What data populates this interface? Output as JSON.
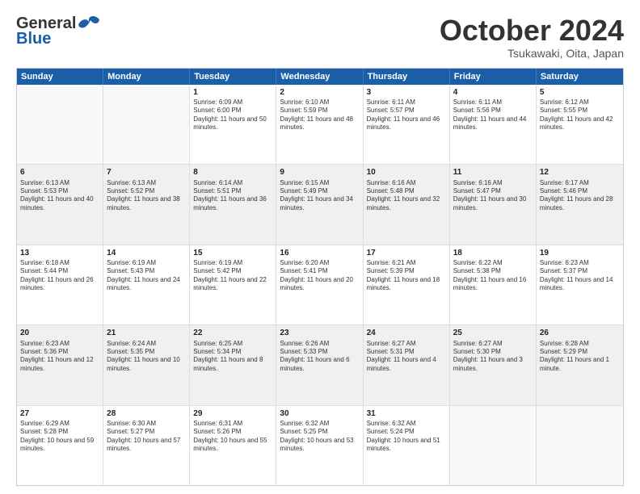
{
  "header": {
    "logo_general": "General",
    "logo_blue": "Blue",
    "month_title": "October 2024",
    "subtitle": "Tsukawaki, Oita, Japan"
  },
  "calendar": {
    "days": [
      "Sunday",
      "Monday",
      "Tuesday",
      "Wednesday",
      "Thursday",
      "Friday",
      "Saturday"
    ],
    "rows": [
      [
        {
          "day": "",
          "empty": true
        },
        {
          "day": "",
          "empty": true
        },
        {
          "day": "1",
          "sunrise": "Sunrise: 6:09 AM",
          "sunset": "Sunset: 6:00 PM",
          "daylight": "Daylight: 11 hours and 50 minutes."
        },
        {
          "day": "2",
          "sunrise": "Sunrise: 6:10 AM",
          "sunset": "Sunset: 5:59 PM",
          "daylight": "Daylight: 11 hours and 48 minutes."
        },
        {
          "day": "3",
          "sunrise": "Sunrise: 6:11 AM",
          "sunset": "Sunset: 5:57 PM",
          "daylight": "Daylight: 11 hours and 46 minutes."
        },
        {
          "day": "4",
          "sunrise": "Sunrise: 6:11 AM",
          "sunset": "Sunset: 5:56 PM",
          "daylight": "Daylight: 11 hours and 44 minutes."
        },
        {
          "day": "5",
          "sunrise": "Sunrise: 6:12 AM",
          "sunset": "Sunset: 5:55 PM",
          "daylight": "Daylight: 11 hours and 42 minutes."
        }
      ],
      [
        {
          "day": "6",
          "sunrise": "Sunrise: 6:13 AM",
          "sunset": "Sunset: 5:53 PM",
          "daylight": "Daylight: 11 hours and 40 minutes."
        },
        {
          "day": "7",
          "sunrise": "Sunrise: 6:13 AM",
          "sunset": "Sunset: 5:52 PM",
          "daylight": "Daylight: 11 hours and 38 minutes."
        },
        {
          "day": "8",
          "sunrise": "Sunrise: 6:14 AM",
          "sunset": "Sunset: 5:51 PM",
          "daylight": "Daylight: 11 hours and 36 minutes."
        },
        {
          "day": "9",
          "sunrise": "Sunrise: 6:15 AM",
          "sunset": "Sunset: 5:49 PM",
          "daylight": "Daylight: 11 hours and 34 minutes."
        },
        {
          "day": "10",
          "sunrise": "Sunrise: 6:16 AM",
          "sunset": "Sunset: 5:48 PM",
          "daylight": "Daylight: 11 hours and 32 minutes."
        },
        {
          "day": "11",
          "sunrise": "Sunrise: 6:16 AM",
          "sunset": "Sunset: 5:47 PM",
          "daylight": "Daylight: 11 hours and 30 minutes."
        },
        {
          "day": "12",
          "sunrise": "Sunrise: 6:17 AM",
          "sunset": "Sunset: 5:46 PM",
          "daylight": "Daylight: 11 hours and 28 minutes."
        }
      ],
      [
        {
          "day": "13",
          "sunrise": "Sunrise: 6:18 AM",
          "sunset": "Sunset: 5:44 PM",
          "daylight": "Daylight: 11 hours and 26 minutes."
        },
        {
          "day": "14",
          "sunrise": "Sunrise: 6:19 AM",
          "sunset": "Sunset: 5:43 PM",
          "daylight": "Daylight: 11 hours and 24 minutes."
        },
        {
          "day": "15",
          "sunrise": "Sunrise: 6:19 AM",
          "sunset": "Sunset: 5:42 PM",
          "daylight": "Daylight: 11 hours and 22 minutes."
        },
        {
          "day": "16",
          "sunrise": "Sunrise: 6:20 AM",
          "sunset": "Sunset: 5:41 PM",
          "daylight": "Daylight: 11 hours and 20 minutes."
        },
        {
          "day": "17",
          "sunrise": "Sunrise: 6:21 AM",
          "sunset": "Sunset: 5:39 PM",
          "daylight": "Daylight: 11 hours and 18 minutes."
        },
        {
          "day": "18",
          "sunrise": "Sunrise: 6:22 AM",
          "sunset": "Sunset: 5:38 PM",
          "daylight": "Daylight: 11 hours and 16 minutes."
        },
        {
          "day": "19",
          "sunrise": "Sunrise: 6:23 AM",
          "sunset": "Sunset: 5:37 PM",
          "daylight": "Daylight: 11 hours and 14 minutes."
        }
      ],
      [
        {
          "day": "20",
          "sunrise": "Sunrise: 6:23 AM",
          "sunset": "Sunset: 5:36 PM",
          "daylight": "Daylight: 11 hours and 12 minutes."
        },
        {
          "day": "21",
          "sunrise": "Sunrise: 6:24 AM",
          "sunset": "Sunset: 5:35 PM",
          "daylight": "Daylight: 11 hours and 10 minutes."
        },
        {
          "day": "22",
          "sunrise": "Sunrise: 6:25 AM",
          "sunset": "Sunset: 5:34 PM",
          "daylight": "Daylight: 11 hours and 8 minutes."
        },
        {
          "day": "23",
          "sunrise": "Sunrise: 6:26 AM",
          "sunset": "Sunset: 5:33 PM",
          "daylight": "Daylight: 11 hours and 6 minutes."
        },
        {
          "day": "24",
          "sunrise": "Sunrise: 6:27 AM",
          "sunset": "Sunset: 5:31 PM",
          "daylight": "Daylight: 11 hours and 4 minutes."
        },
        {
          "day": "25",
          "sunrise": "Sunrise: 6:27 AM",
          "sunset": "Sunset: 5:30 PM",
          "daylight": "Daylight: 11 hours and 3 minutes."
        },
        {
          "day": "26",
          "sunrise": "Sunrise: 6:28 AM",
          "sunset": "Sunset: 5:29 PM",
          "daylight": "Daylight: 11 hours and 1 minute."
        }
      ],
      [
        {
          "day": "27",
          "sunrise": "Sunrise: 6:29 AM",
          "sunset": "Sunset: 5:28 PM",
          "daylight": "Daylight: 10 hours and 59 minutes."
        },
        {
          "day": "28",
          "sunrise": "Sunrise: 6:30 AM",
          "sunset": "Sunset: 5:27 PM",
          "daylight": "Daylight: 10 hours and 57 minutes."
        },
        {
          "day": "29",
          "sunrise": "Sunrise: 6:31 AM",
          "sunset": "Sunset: 5:26 PM",
          "daylight": "Daylight: 10 hours and 55 minutes."
        },
        {
          "day": "30",
          "sunrise": "Sunrise: 6:32 AM",
          "sunset": "Sunset: 5:25 PM",
          "daylight": "Daylight: 10 hours and 53 minutes."
        },
        {
          "day": "31",
          "sunrise": "Sunrise: 6:32 AM",
          "sunset": "Sunset: 5:24 PM",
          "daylight": "Daylight: 10 hours and 51 minutes."
        },
        {
          "day": "",
          "empty": true
        },
        {
          "day": "",
          "empty": true
        }
      ]
    ]
  }
}
